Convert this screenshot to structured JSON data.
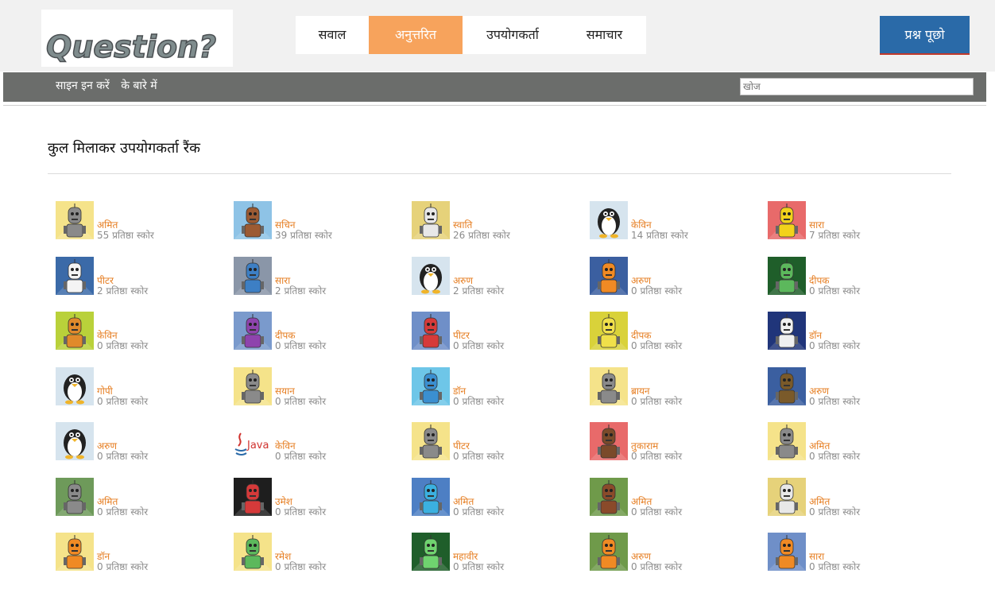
{
  "header": {
    "logo_text": "Question?",
    "nav": [
      {
        "label": "सवाल",
        "active": false
      },
      {
        "label": "अनुत्तरित",
        "active": true
      },
      {
        "label": "उपयोगकर्ता",
        "active": false
      },
      {
        "label": "समाचार",
        "active": false
      }
    ],
    "ask_button": "प्रश्न पूछो"
  },
  "subbar": {
    "signin": "साइन इन करें",
    "about": "के बारे में",
    "search_placeholder": "खोज"
  },
  "main": {
    "title": "कुल मिलाकर उपयोगकर्ता रैंक",
    "users": [
      {
        "name": "अमित",
        "score": "55 प्रतिष्ठा स्कोर",
        "avatar": "robot-icon",
        "bg": "#f5e38a",
        "color": "#8a8a8a"
      },
      {
        "name": "सचिन",
        "score": "39 प्रतिष्ठा स्कोर",
        "avatar": "robot-icon",
        "bg": "#8ec3e6",
        "color": "#9c5b33"
      },
      {
        "name": "स्वाति",
        "score": "26 प्रतिष्ठा स्कोर",
        "avatar": "robot-icon",
        "bg": "#e6d27a",
        "color": "#e8e8e8"
      },
      {
        "name": "केविन",
        "score": "14 प्रतिष्ठा स्कोर",
        "avatar": "penguin-icon",
        "bg": "#d6e4ee",
        "color": "#222222"
      },
      {
        "name": "सारा",
        "score": "7 प्रतिष्ठा स्कोर",
        "avatar": "robot-icon",
        "bg": "#e86a6a",
        "color": "#f2d21b"
      },
      {
        "name": "पीटर",
        "score": "2 प्रतिष्ठा स्कोर",
        "avatar": "robot-icon",
        "bg": "#3b6aa8",
        "color": "#f4f4f4"
      },
      {
        "name": "सारा",
        "score": "2 प्रतिष्ठा स्कोर",
        "avatar": "robot-icon",
        "bg": "#8a96a8",
        "color": "#3d7fc4"
      },
      {
        "name": "अरुण",
        "score": "2 प्रतिष्ठा स्कोर",
        "avatar": "penguin-icon",
        "bg": "#d6e4ee",
        "color": "#222222"
      },
      {
        "name": "अरुण",
        "score": "0 प्रतिष्ठा स्कोर",
        "avatar": "robot-icon",
        "bg": "#3b5fa0",
        "color": "#f08a24"
      },
      {
        "name": "दीपक",
        "score": "0 प्रतिष्ठा स्कोर",
        "avatar": "robot-icon",
        "bg": "#1f5e2a",
        "color": "#5cb85c"
      },
      {
        "name": "केविन",
        "score": "0 प्रतिष्ठा स्कोर",
        "avatar": "robot-icon",
        "bg": "#b9d13a",
        "color": "#e08a2b"
      },
      {
        "name": "दीपक",
        "score": "0 प्रतिष्ठा स्कोर",
        "avatar": "robot-icon",
        "bg": "#7a9acc",
        "color": "#8e44ad"
      },
      {
        "name": "पीटर",
        "score": "0 प्रतिष्ठा स्कोर",
        "avatar": "robot-icon",
        "bg": "#6f8fc8",
        "color": "#d63a3a"
      },
      {
        "name": "दीपक",
        "score": "0 प्रतिष्ठा स्कोर",
        "avatar": "robot-icon",
        "bg": "#d9d23a",
        "color": "#f0e04a"
      },
      {
        "name": "डॉन",
        "score": "0 प्रतिष्ठा स्कोर",
        "avatar": "robot-icon",
        "bg": "#20357a",
        "color": "#f0f0f0"
      },
      {
        "name": "गोपी",
        "score": "0 प्रतिष्ठा स्कोर",
        "avatar": "penguin-icon",
        "bg": "#d6e4ee",
        "color": "#222222"
      },
      {
        "name": "सयान",
        "score": "0 प्रतिष्ठा स्कोर",
        "avatar": "robot-icon",
        "bg": "#f5e38a",
        "color": "#8a8a8a"
      },
      {
        "name": "डॉन",
        "score": "0 प्रतिष्ठा स्कोर",
        "avatar": "robot-icon",
        "bg": "#6ec6e8",
        "color": "#3b8fd0"
      },
      {
        "name": "ब्रायन",
        "score": "0 प्रतिष्ठा स्कोर",
        "avatar": "robot-icon",
        "bg": "#f5e38a",
        "color": "#8a8a8a"
      },
      {
        "name": "अरुण",
        "score": "0 प्रतिष्ठा स्कोर",
        "avatar": "robot-icon",
        "bg": "#3b5fa0",
        "color": "#7a5a2a"
      },
      {
        "name": "अरुण",
        "score": "0 प्रतिष्ठा स्कोर",
        "avatar": "penguin-icon",
        "bg": "#d6e4ee",
        "color": "#222222"
      },
      {
        "name": "केविन",
        "score": "0 प्रतिष्ठा स्कोर",
        "avatar": "java-icon",
        "bg": "#ffffff",
        "color": "#d0332f"
      },
      {
        "name": "पीटर",
        "score": "0 प्रतिष्ठा स्कोर",
        "avatar": "robot-icon",
        "bg": "#f5e38a",
        "color": "#8a8a8a"
      },
      {
        "name": "तुकाराम",
        "score": "0 प्रतिष्ठा स्कोर",
        "avatar": "robot-icon",
        "bg": "#e86a6a",
        "color": "#7a4a2a"
      },
      {
        "name": "अमित",
        "score": "0 प्रतिष्ठा स्कोर",
        "avatar": "robot-icon",
        "bg": "#f5e38a",
        "color": "#8a8a8a"
      },
      {
        "name": "अमित",
        "score": "0 प्रतिष्ठा स्कोर",
        "avatar": "robot-icon",
        "bg": "#6e9a5a",
        "color": "#8a8a8a"
      },
      {
        "name": "उमेश",
        "score": "0 प्रतिष्ठा स्कोर",
        "avatar": "robot-icon",
        "bg": "#1e1e1e",
        "color": "#d63a3a"
      },
      {
        "name": "अमित",
        "score": "0 प्रतिष्ठा स्कोर",
        "avatar": "robot-icon",
        "bg": "#4d7fc4",
        "color": "#3bb0e0"
      },
      {
        "name": "अमित",
        "score": "0 प्रतिष्ठा स्कोर",
        "avatar": "robot-icon",
        "bg": "#6f9a4a",
        "color": "#8a4a2a"
      },
      {
        "name": "अमित",
        "score": "0 प्रतिष्ठा स्कोर",
        "avatar": "robot-icon",
        "bg": "#e6d27a",
        "color": "#e8e8e8"
      },
      {
        "name": "डॉन",
        "score": "0 प्रतिष्ठा स्कोर",
        "avatar": "robot-icon",
        "bg": "#f5e38a",
        "color": "#f08a24"
      },
      {
        "name": "रमेश",
        "score": "0 प्रतिष्ठा स्कोर",
        "avatar": "robot-icon",
        "bg": "#f5e38a",
        "color": "#5cb85c"
      },
      {
        "name": "महावीर",
        "score": "0 प्रतिष्ठा स्कोर",
        "avatar": "robot-icon",
        "bg": "#1f5e2a",
        "color": "#6fd36f"
      },
      {
        "name": "अरुण",
        "score": "0 प्रतिष्ठा स्कोर",
        "avatar": "robot-icon",
        "bg": "#6f9a4a",
        "color": "#f08a24"
      },
      {
        "name": "सारा",
        "score": "0 प्रतिष्ठा स्कोर",
        "avatar": "robot-icon",
        "bg": "#6f8fc8",
        "color": "#f08a24"
      }
    ]
  }
}
